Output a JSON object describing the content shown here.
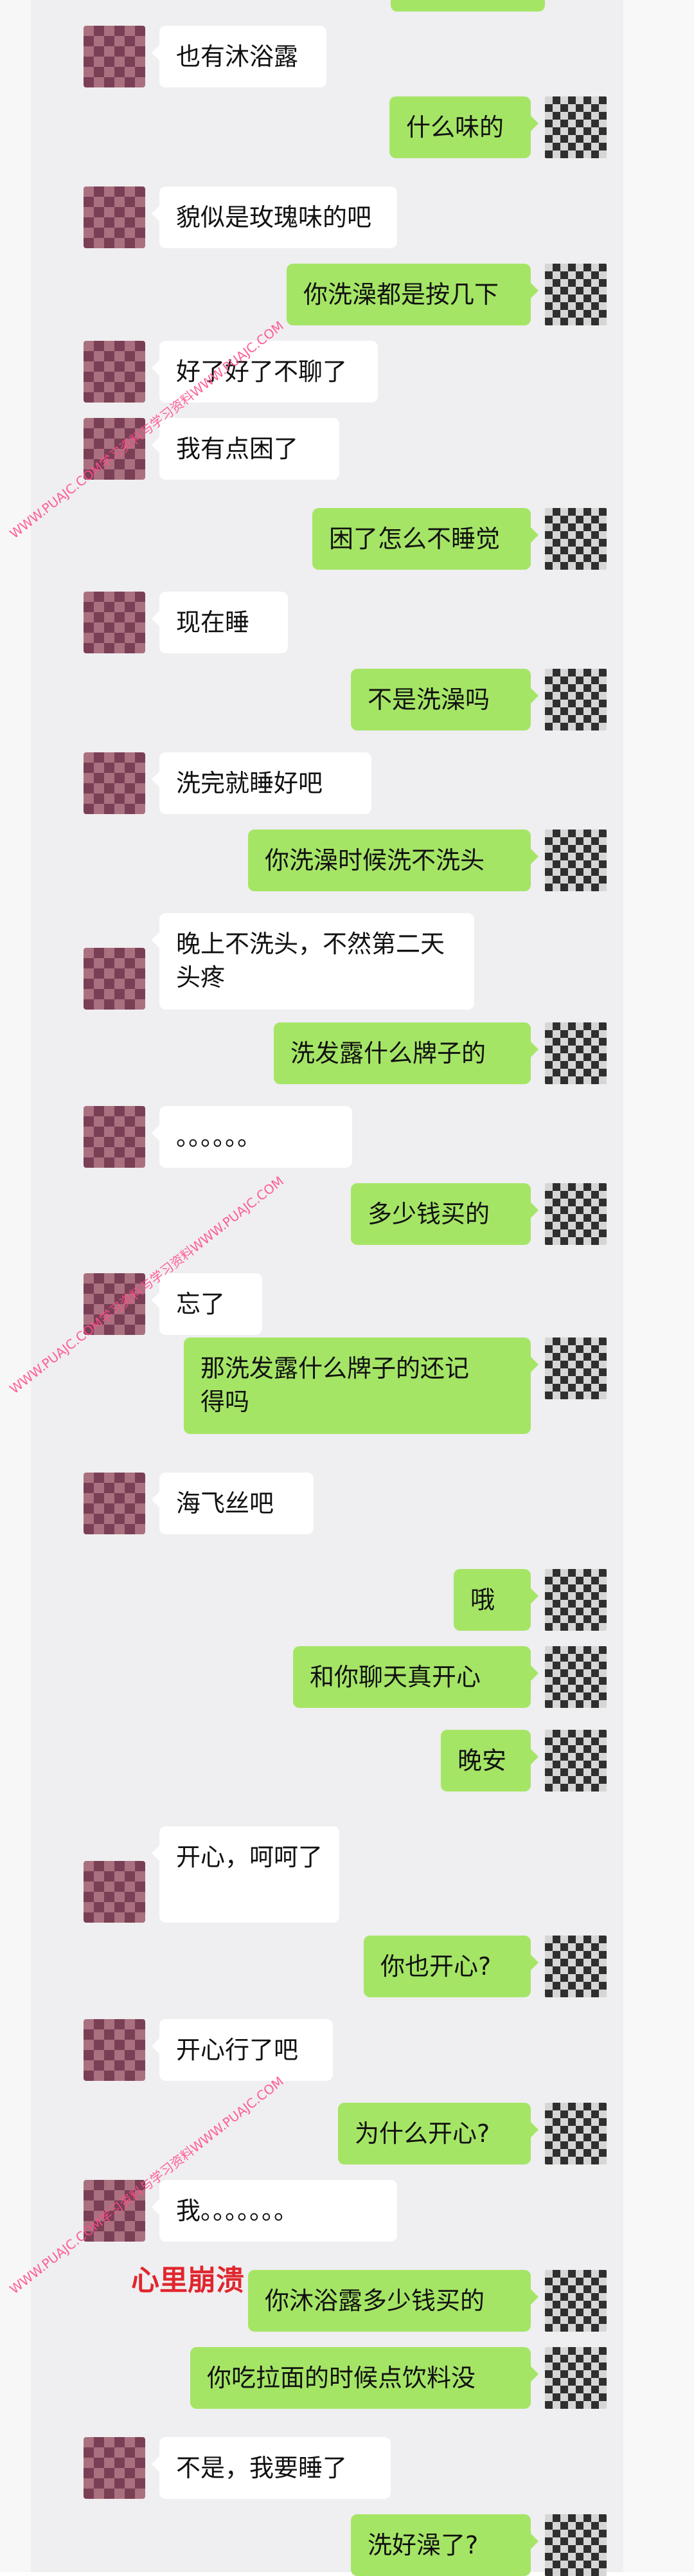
{
  "conversation": {
    "messages": [
      {
        "from": "them",
        "text": "也有沐浴露"
      },
      {
        "from": "me",
        "text": "什么味的"
      },
      {
        "from": "them",
        "text": "貌似是玫瑰味的吧"
      },
      {
        "from": "me",
        "text": "你洗澡都是按几下"
      },
      {
        "from": "them",
        "text": "好了好了不聊了"
      },
      {
        "from": "them",
        "text": "我有点困了"
      },
      {
        "from": "me",
        "text": "困了怎么不睡觉"
      },
      {
        "from": "them",
        "text": "现在睡"
      },
      {
        "from": "me",
        "text": "不是洗澡吗"
      },
      {
        "from": "them",
        "text": "洗完就睡好吧"
      },
      {
        "from": "me",
        "text": "你洗澡时候洗不洗头"
      },
      {
        "from": "them",
        "text": "晚上不洗头，不然第二天\n头疼"
      },
      {
        "from": "me",
        "text": "洗发露什么牌子的"
      },
      {
        "from": "them",
        "text": "。。。。。。"
      },
      {
        "from": "me",
        "text": "多少钱买的"
      },
      {
        "from": "them",
        "text": "忘了"
      },
      {
        "from": "me",
        "text": "那洗发露什么牌子的还记\n得吗"
      },
      {
        "from": "them",
        "text": "海飞丝吧"
      },
      {
        "from": "me",
        "text": "哦"
      },
      {
        "from": "me",
        "text": "和你聊天真开心"
      },
      {
        "from": "me",
        "text": "晚安"
      },
      {
        "from": "them",
        "text": "开心，呵呵了"
      },
      {
        "from": "me",
        "text": "你也开心?"
      },
      {
        "from": "them",
        "text": "开心行了吧"
      },
      {
        "from": "me",
        "text": "为什么开心?"
      },
      {
        "from": "them",
        "text": "我。。。。。。。"
      },
      {
        "from": "me",
        "text": "你沐浴露多少钱买的"
      },
      {
        "from": "me",
        "text": "你吃拉面的时候点饮料没"
      },
      {
        "from": "them",
        "text": "不是，我要睡了"
      },
      {
        "from": "me",
        "text": "洗好澡了?"
      }
    ]
  },
  "annotation": {
    "text": "心里崩溃"
  },
  "watermark": {
    "text": "WWW.PUAJC.COM学习资料与学习资料WWW.PUAJC.COM"
  },
  "colors": {
    "incoming_bubble": "#ffffff",
    "outgoing_bubble": "#a5e566",
    "annotation": "#e0262e",
    "watermark": "#ff4f8c"
  }
}
